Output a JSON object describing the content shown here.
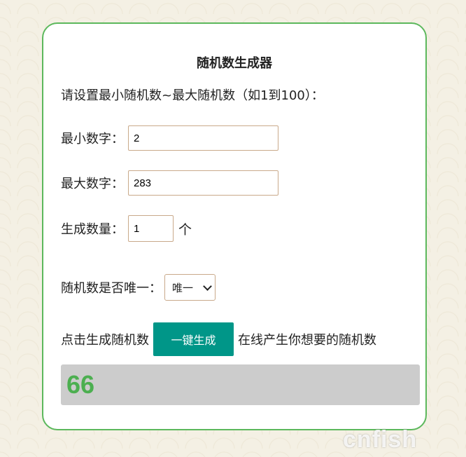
{
  "title": "随机数生成器",
  "intro": "请设置最小随机数~最大随机数（如1到100）：",
  "min": {
    "label": "最小数字：",
    "value": "2"
  },
  "max": {
    "label": "最大数字：",
    "value": "283"
  },
  "count": {
    "label": "生成数量：",
    "value": "1",
    "unit": "个"
  },
  "unique": {
    "label": "随机数是否唯一：",
    "selected": "唯一"
  },
  "generate": {
    "prefix": "点击生成随机数",
    "button": "一键生成",
    "suffix": "在线产生你想要的随机数"
  },
  "result": "66",
  "watermark": "cnfish",
  "colors": {
    "border": "#5cb85c",
    "button": "#009688",
    "result_text": "#4caf50",
    "result_bg": "#cccccc"
  }
}
